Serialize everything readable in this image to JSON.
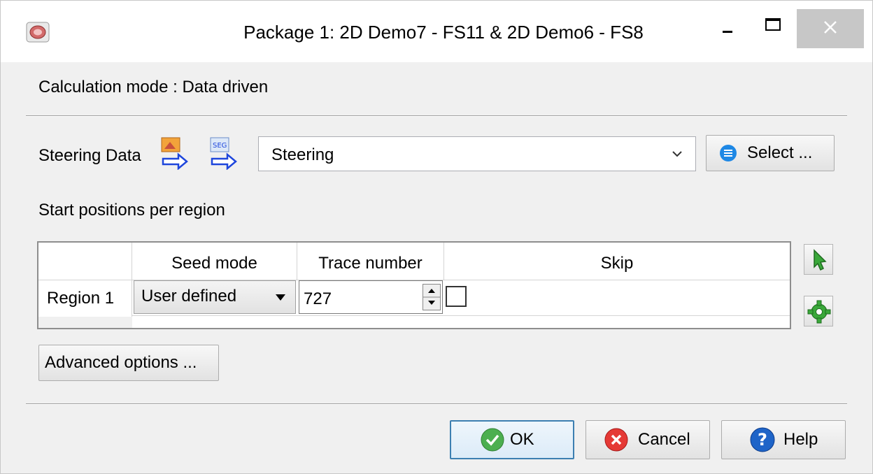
{
  "window": {
    "title": "Package 1: 2D Demo7 - FS11 & 2D Demo6 - FS8"
  },
  "calculation_mode_label": "Calculation mode : Data driven",
  "steering": {
    "label": "Steering Data",
    "combo_value": "Steering",
    "select_button": "Select ..."
  },
  "start_positions_label": "Start positions per region",
  "table": {
    "columns": [
      "",
      "Seed mode",
      "Trace number",
      "Skip"
    ],
    "rows": [
      {
        "region": "Region 1",
        "seed_mode": "User defined",
        "trace_number": "727",
        "skip": false
      }
    ]
  },
  "advanced_button": "Advanced options ...",
  "footer": {
    "ok": "OK",
    "cancel": "Cancel",
    "help": "Help"
  },
  "colors": {
    "ok_icon": "#4caf50",
    "cancel_icon": "#e53935",
    "help_icon": "#1e64c8",
    "select_icon": "#1e88e5",
    "default_button_border": "#3c7fb1"
  }
}
